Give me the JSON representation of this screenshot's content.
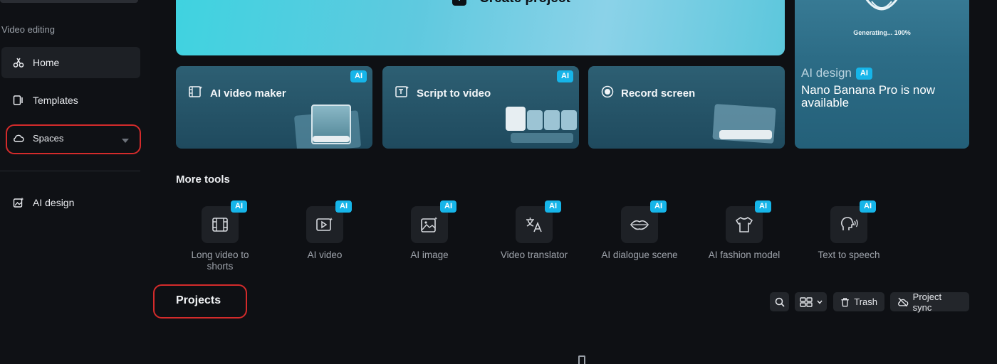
{
  "sidebar": {
    "section_label": "Video editing",
    "items": [
      {
        "label": "Home",
        "icon": "home-icon"
      },
      {
        "label": "Templates",
        "icon": "templates-icon"
      },
      {
        "label": "Spaces",
        "icon": "cloud-icon"
      },
      {
        "label": "AI design",
        "icon": "ai-design-icon"
      }
    ]
  },
  "hero": {
    "create_label": "Create project",
    "cards": [
      {
        "title": "AI video maker",
        "badge": "AI",
        "icon": "film-icon"
      },
      {
        "title": "Script to video",
        "badge": "AI",
        "icon": "script-icon"
      },
      {
        "title": "Record screen",
        "badge": "",
        "icon": "record-icon"
      }
    ],
    "promo": {
      "status": "Generating... 100%",
      "kicker": "AI design",
      "badge": "AI",
      "headline": "Nano Banana Pro is now available"
    }
  },
  "more_tools": {
    "heading": "More tools",
    "badge": "AI",
    "tools": [
      {
        "name": "Long video to shorts",
        "icon": "long-video-icon"
      },
      {
        "name": "AI video",
        "icon": "ai-video-icon"
      },
      {
        "name": "AI image",
        "icon": "ai-image-icon"
      },
      {
        "name": "Video translator",
        "icon": "translate-icon"
      },
      {
        "name": "AI dialogue scene",
        "icon": "lips-icon"
      },
      {
        "name": "AI fashion model",
        "icon": "shirt-icon"
      },
      {
        "name": "Text to speech",
        "icon": "speech-icon"
      }
    ]
  },
  "projects": {
    "title": "Projects",
    "trash_label": "Trash",
    "sync_label": "Project sync"
  },
  "colors": {
    "accent_badge": "#16b5e9",
    "highlight_ring": "#d42b2b",
    "background": "#0e1014"
  }
}
